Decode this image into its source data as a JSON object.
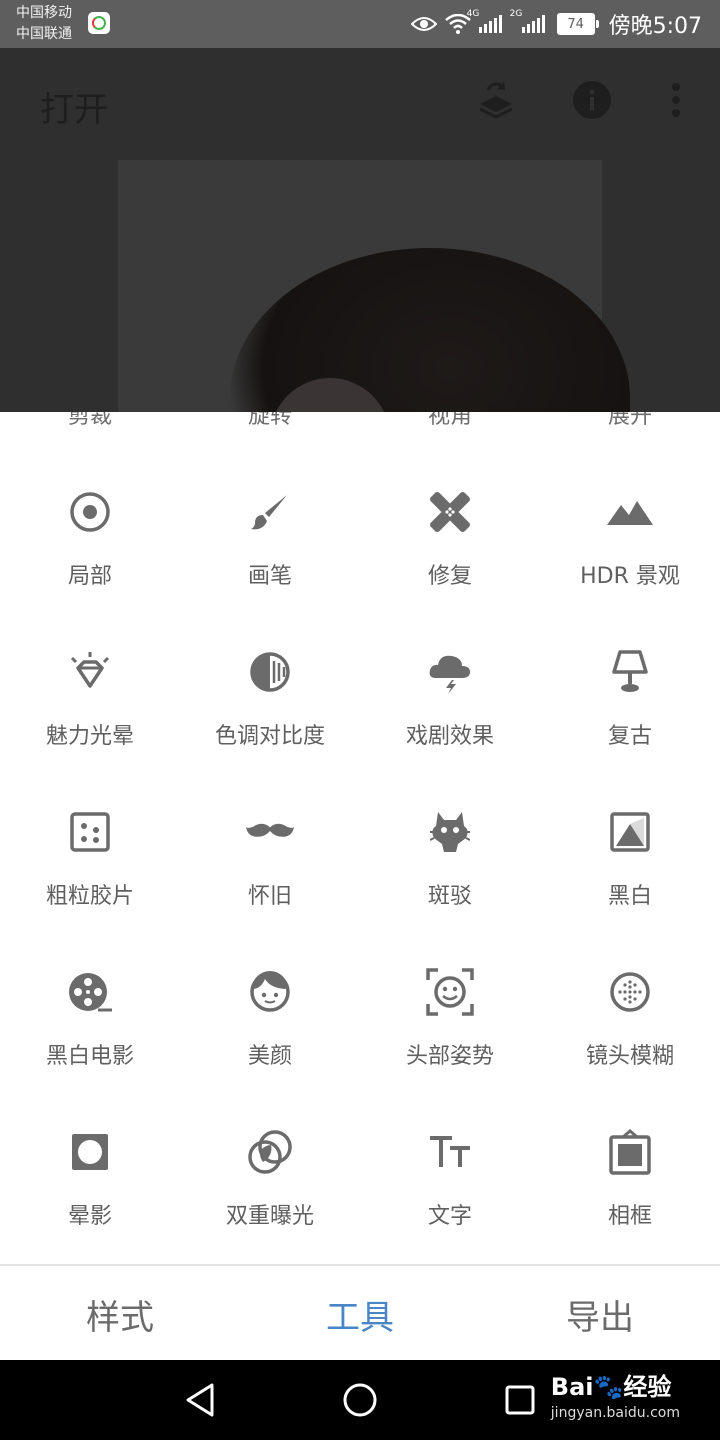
{
  "status_bar": {
    "carrier1": "中国移动",
    "carrier2": "中国联通",
    "net1": "4G",
    "net2": "2G",
    "battery": "74",
    "time": "傍晚5:07"
  },
  "header": {
    "title": "打开",
    "icons": [
      "layers-swap-icon",
      "info-icon",
      "more-vert-icon"
    ]
  },
  "sheet": {
    "cut_row": [
      "剪裁",
      "旋转",
      "视角",
      "展开"
    ],
    "tools": [
      {
        "label": "局部",
        "icon": "selective-icon"
      },
      {
        "label": "画笔",
        "icon": "brush-icon"
      },
      {
        "label": "修复",
        "icon": "healing-icon"
      },
      {
        "label": "HDR 景观",
        "icon": "hdr-landscape-icon"
      },
      {
        "label": "魅力光晕",
        "icon": "glamour-glow-icon"
      },
      {
        "label": "色调对比度",
        "icon": "tonal-contrast-icon"
      },
      {
        "label": "戏剧效果",
        "icon": "drama-icon"
      },
      {
        "label": "复古",
        "icon": "vintage-lamp-icon"
      },
      {
        "label": "粗粒胶片",
        "icon": "grainy-film-icon"
      },
      {
        "label": "怀旧",
        "icon": "retrolux-mustache-icon"
      },
      {
        "label": "斑驳",
        "icon": "grunge-icon"
      },
      {
        "label": "黑白",
        "icon": "black-white-icon"
      },
      {
        "label": "黑白电影",
        "icon": "noir-film-reel-icon"
      },
      {
        "label": "美颜",
        "icon": "face-icon"
      },
      {
        "label": "头部姿势",
        "icon": "head-pose-icon"
      },
      {
        "label": "镜头模糊",
        "icon": "lens-blur-icon"
      },
      {
        "label": "晕影",
        "icon": "vignette-icon"
      },
      {
        "label": "双重曝光",
        "icon": "double-exposure-icon"
      },
      {
        "label": "文字",
        "icon": "text-icon"
      },
      {
        "label": "相框",
        "icon": "frames-icon"
      }
    ]
  },
  "tabs": [
    {
      "label": "样式",
      "active": false
    },
    {
      "label": "工具",
      "active": true
    },
    {
      "label": "导出",
      "active": false
    }
  ],
  "watermark": {
    "brand": "Bai🐾经验",
    "url": "jingyan.baidu.com"
  },
  "colors": {
    "accent": "#4a86c5",
    "icon": "#6b6b6b",
    "overlay": "#2f2f2f"
  }
}
